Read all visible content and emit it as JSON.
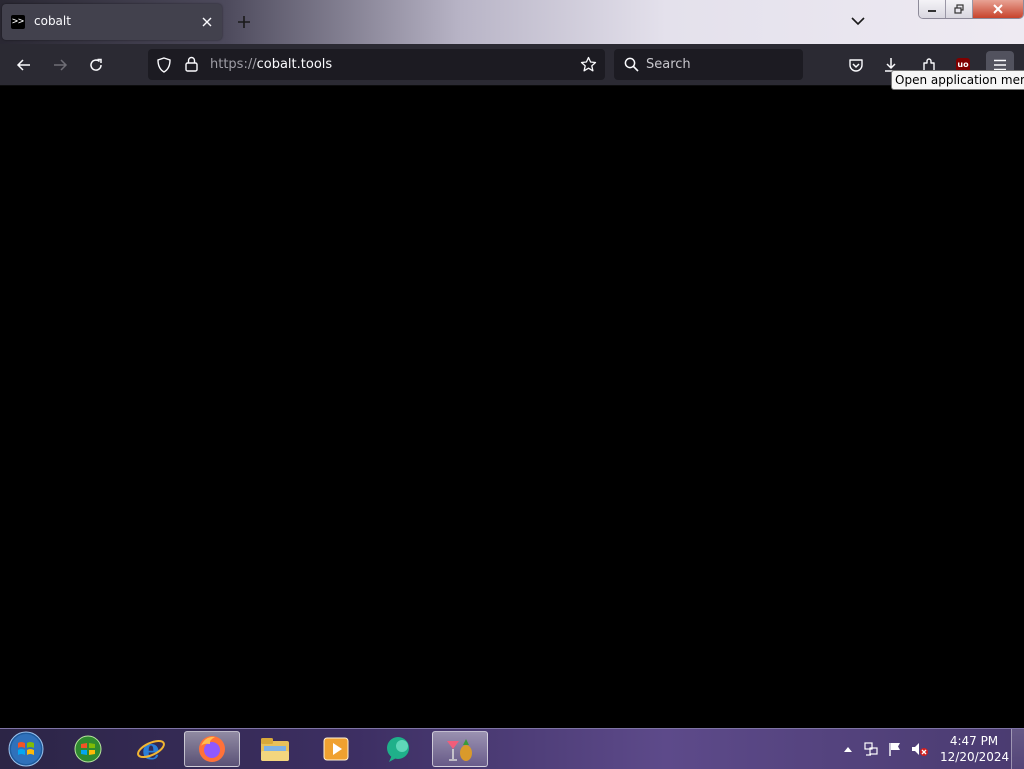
{
  "browser": {
    "tab": {
      "title": "cobalt",
      "favicon": ">>"
    },
    "icons": {
      "new_tab": "plus-icon",
      "tab_close": "close-icon",
      "list_all_tabs": "chevron-down-icon"
    },
    "nav": {
      "url_protocol": "https://",
      "url_host": "cobalt.tools",
      "search_placeholder": "Search"
    },
    "toolbar_icons": [
      "pocket-icon",
      "download-icon",
      "extensions-icon",
      "ublock-origin-icon",
      "hamburger-menu-icon"
    ],
    "ublock_label": "uo",
    "tooltip": "Open application menu"
  },
  "taskbar": {
    "apps": [
      "Windows Media Center",
      "Internet Explorer",
      "Firefox",
      "Windows Explorer",
      "Windows Media Player",
      "Chat",
      "Games"
    ],
    "clock": {
      "time": "4:47 PM",
      "date": "12/20/2024"
    }
  },
  "colors": {
    "toolbar_bg": "#2b2a33",
    "urlbar_bg": "#1c1b22",
    "content_bg": "#000000",
    "tab_bg": "#42414d"
  }
}
